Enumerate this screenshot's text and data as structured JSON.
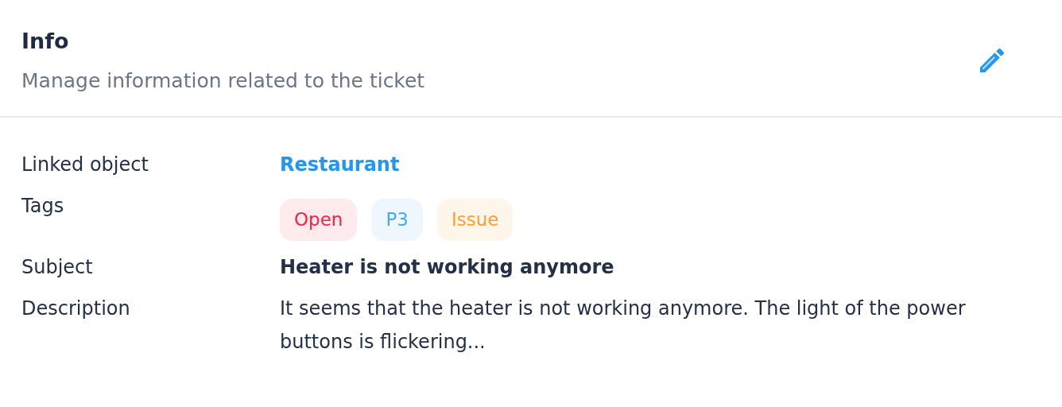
{
  "header": {
    "title": "Info",
    "subtitle": "Manage information related to the ticket"
  },
  "fields": [
    {
      "label": "Linked object",
      "kind": "link",
      "value": "Restaurant"
    },
    {
      "label": "Tags",
      "kind": "tags",
      "tags": [
        {
          "text": "Open",
          "color": "#ff1f44"
        },
        {
          "text": "P3",
          "color": "#4aaaf5"
        },
        {
          "text": "Issue",
          "color": "#ff9f2e"
        }
      ]
    },
    {
      "label": "Subject",
      "kind": "bold",
      "value": "Heater is not working anymore"
    },
    {
      "label": "Description",
      "kind": "text",
      "value": "It seems that the heater is not working anymore. The light of the power buttons is flickering..."
    }
  ]
}
